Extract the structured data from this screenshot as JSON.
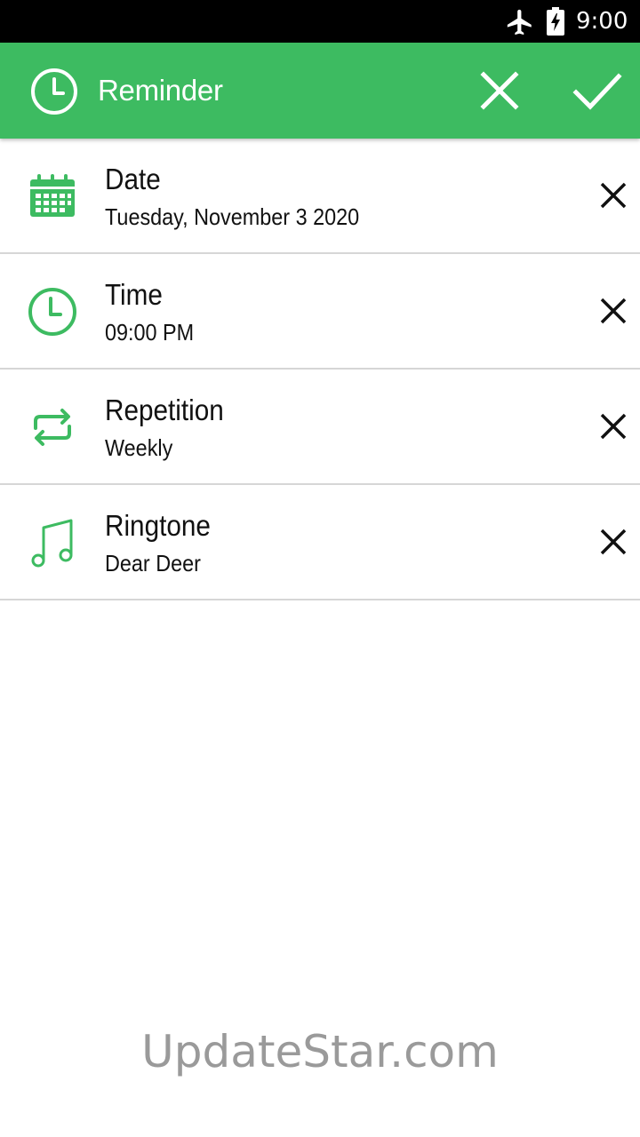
{
  "status_bar": {
    "time": "9:00",
    "icons": [
      "airplane-mode-icon",
      "battery-charging-icon"
    ]
  },
  "app_bar": {
    "title": "Reminder",
    "icon": "clock-icon",
    "actions": [
      "close-icon",
      "check-icon"
    ]
  },
  "items": [
    {
      "label": "Date",
      "value": "Tuesday, November 3 2020",
      "icon": "calendar-icon"
    },
    {
      "label": "Time",
      "value": "09:00 PM",
      "icon": "clock-icon"
    },
    {
      "label": "Repetition",
      "value": "Weekly",
      "icon": "repeat-icon"
    },
    {
      "label": "Ringtone",
      "value": "Dear Deer",
      "icon": "music-note-icon"
    }
  ],
  "watermark": "UpdateStar.com",
  "colors": {
    "accent": "#3dbb61",
    "status_bar": "#000000",
    "text": "#111111",
    "divider": "#d6d6d6",
    "watermark": "#9a9a9a"
  }
}
